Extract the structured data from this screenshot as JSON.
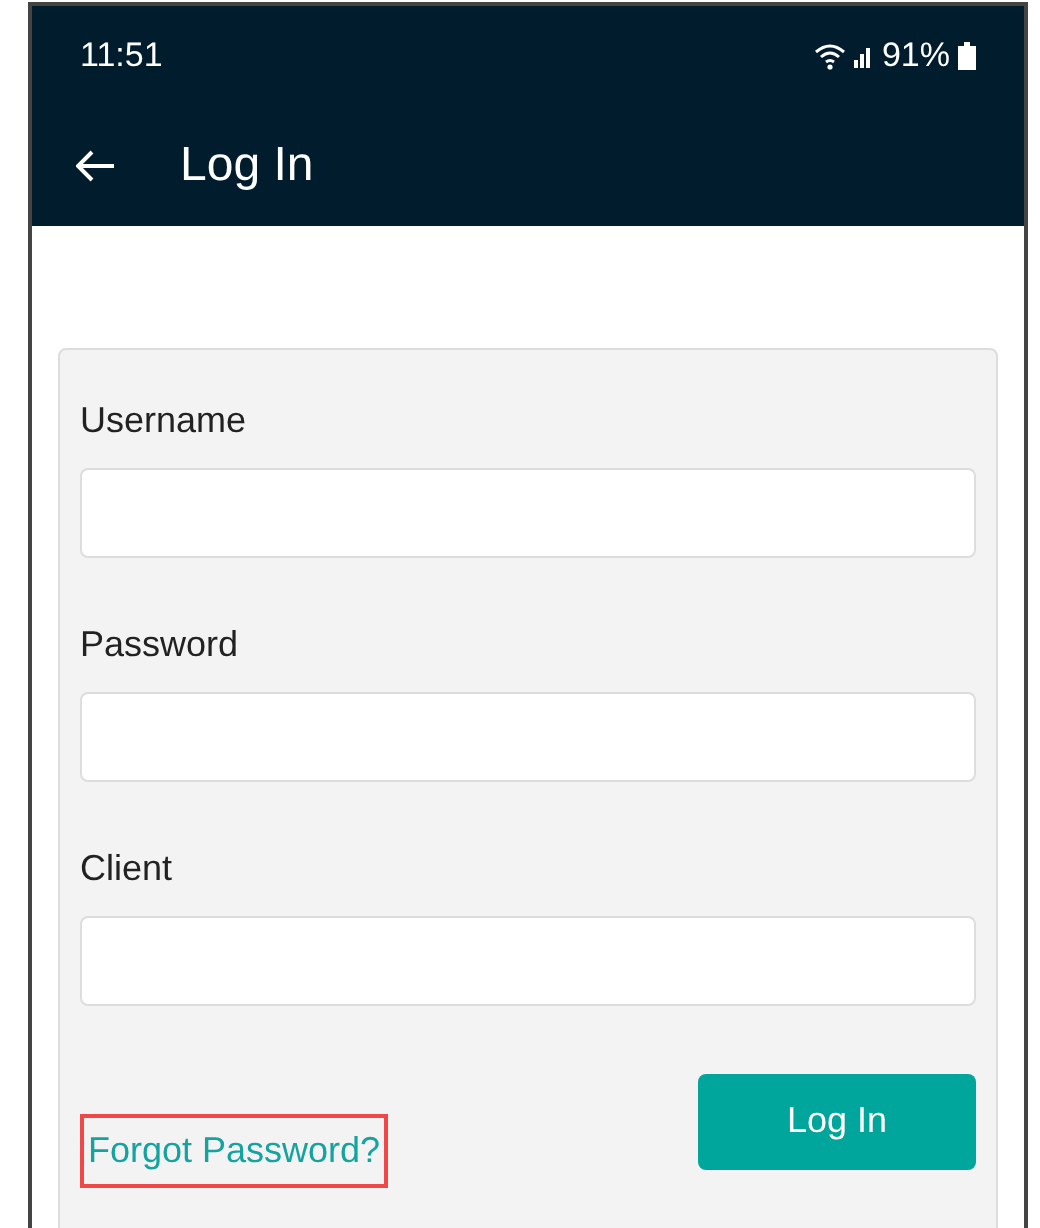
{
  "status_bar": {
    "time": "11:51",
    "battery": "91%"
  },
  "app_bar": {
    "title": "Log In"
  },
  "form": {
    "fields": [
      {
        "label": "Username"
      },
      {
        "label": "Password"
      },
      {
        "label": "Client"
      }
    ],
    "forgot_link": {
      "label": "Forgot Password?",
      "highlighted": true
    },
    "submit": "Log In"
  }
}
